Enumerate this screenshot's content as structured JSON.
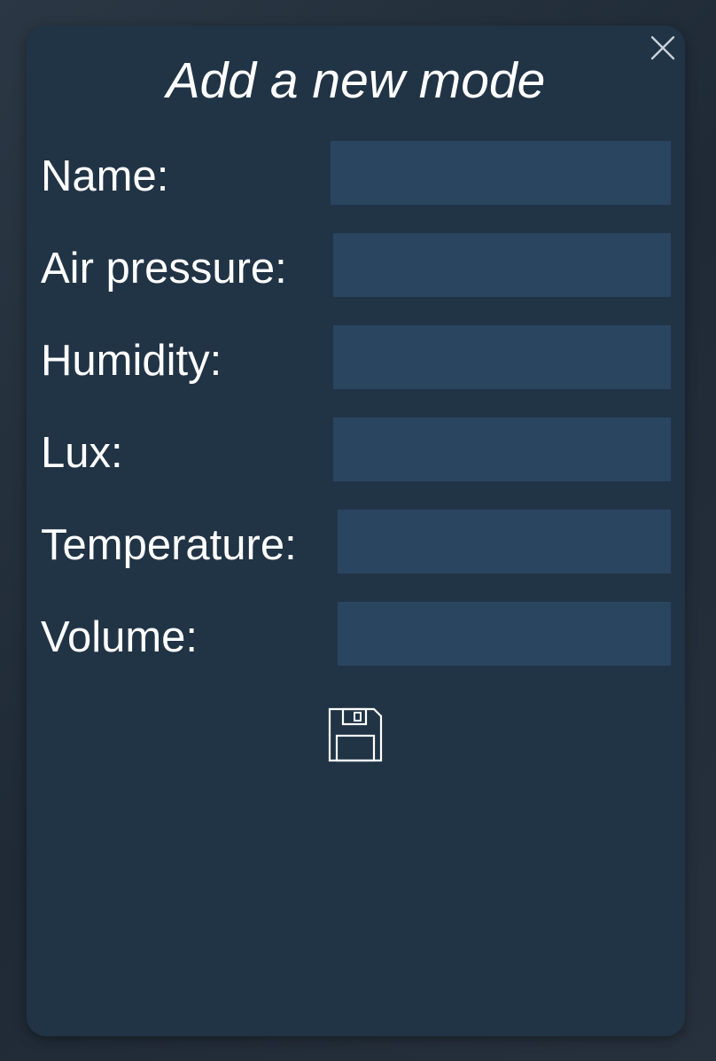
{
  "dialog": {
    "title": "Add a new mode",
    "close_icon": "close-icon",
    "save_icon": "save-icon"
  },
  "form": {
    "fields": [
      {
        "key": "name",
        "label": "Name:",
        "value": ""
      },
      {
        "key": "air_pressure",
        "label": "Air pressure:",
        "value": ""
      },
      {
        "key": "humidity",
        "label": "Humidity:",
        "value": ""
      },
      {
        "key": "lux",
        "label": "Lux:",
        "value": ""
      },
      {
        "key": "temperature",
        "label": "Temperature:",
        "value": ""
      },
      {
        "key": "volume",
        "label": "Volume:",
        "value": ""
      }
    ]
  },
  "colors": {
    "dialog_bg": "#213446",
    "input_bg": "#2a4560",
    "text": "#ffffff"
  }
}
